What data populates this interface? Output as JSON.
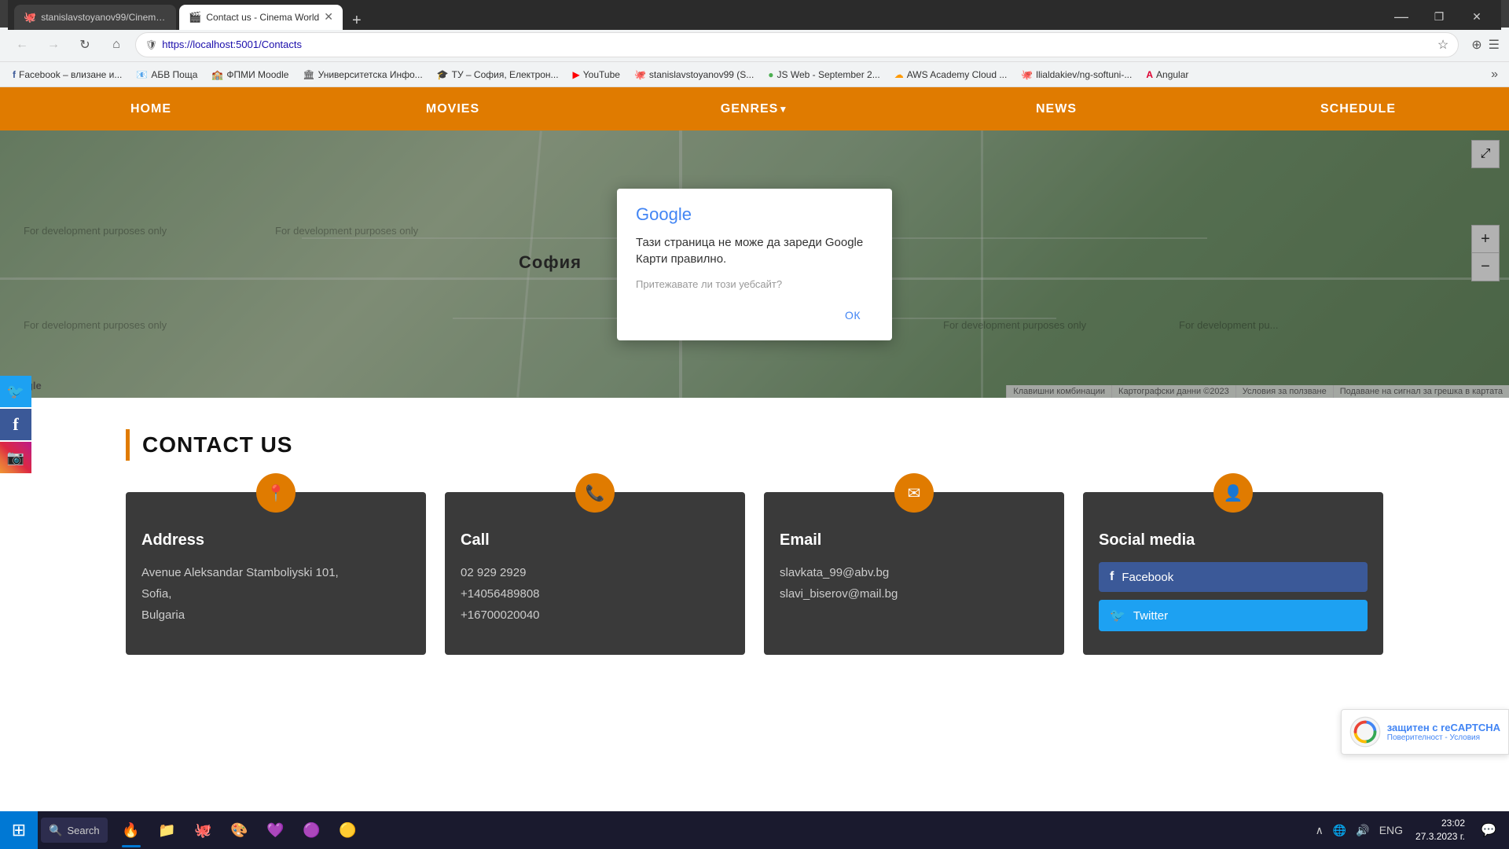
{
  "browser": {
    "tabs": [
      {
        "id": "tab1",
        "title": "stanislavstoyanov99/CinemaWo...",
        "active": false,
        "icon": "🐙"
      },
      {
        "id": "tab2",
        "title": "Contact us - Cinema World",
        "active": true,
        "icon": "🎬"
      }
    ],
    "url": "https://localhost:5001/Contacts",
    "new_tab_label": "+",
    "window_controls": [
      "—",
      "❐",
      "✕"
    ]
  },
  "bookmarks": [
    {
      "label": "Facebook – влизане и...",
      "icon": "f",
      "color": "#3b5998"
    },
    {
      "label": "АБВ Поща",
      "icon": "📧",
      "color": "#e53935"
    },
    {
      "label": "ФПМИ Moodle",
      "icon": "📚",
      "color": "#f57c00"
    },
    {
      "label": "Университетска Инфо...",
      "icon": "🏛",
      "color": "#1565c0"
    },
    {
      "label": "ТУ – София, Електрон...",
      "icon": "🎓",
      "color": "#1565c0"
    },
    {
      "label": "YouTube",
      "icon": "▶",
      "color": "#ff0000"
    },
    {
      "label": "stanislavstoyanov99 (S...",
      "icon": "🐙",
      "color": "#333"
    },
    {
      "label": "JS Web - September 2...",
      "icon": "🟢",
      "color": "#4caf50"
    },
    {
      "label": "AWS Academy Cloud ...",
      "icon": "☁",
      "color": "#ff9900"
    },
    {
      "label": "llialdakiev/ng-softuni-...",
      "icon": "🐙",
      "color": "#333"
    },
    {
      "label": "Angular",
      "icon": "A",
      "color": "#dd0031"
    }
  ],
  "nav": {
    "items": [
      {
        "label": "HOME",
        "has_arrow": false
      },
      {
        "label": "MOVIES",
        "has_arrow": false
      },
      {
        "label": "GENRES",
        "has_arrow": true
      },
      {
        "label": "NEWS",
        "has_arrow": false
      },
      {
        "label": "SCHEDULE",
        "has_arrow": false
      }
    ]
  },
  "map": {
    "city_label": "София",
    "dev_texts": [
      "For development purposes only",
      "For development purposes only",
      "For development purposes only",
      "For development purposes only",
      "For development purposes only",
      "For development purposes only"
    ],
    "watermark": "Google",
    "bottom_bar": [
      "Клавишни комбинации",
      "Картографски данни ©2023",
      "Условия за ползване",
      "Подаване на сигнал за грешка в картата"
    ]
  },
  "google_dialog": {
    "logo": "Google",
    "title": "Тази страница не може да зареди Google Карти правилно.",
    "subtitle": "Притежавате ли този уебсайт?",
    "ok_label": "ОК"
  },
  "contact": {
    "section_title": "CONTACT US",
    "cards": [
      {
        "id": "address",
        "icon": "📍",
        "title": "Address",
        "lines": [
          "Avenue Aleksandar Stamboliyski 101,",
          "Sofia,",
          "Bulgaria"
        ]
      },
      {
        "id": "call",
        "icon": "📞",
        "title": "Call",
        "lines": [
          "02 929 2929",
          "+14056489808",
          "+16700020040"
        ]
      },
      {
        "id": "email",
        "icon": "✉",
        "title": "Email",
        "lines": [
          "slavkata_99@abv.bg",
          "slavi_biserov@mail.bg"
        ]
      },
      {
        "id": "social",
        "icon": "👤",
        "title": "Social media",
        "social_buttons": [
          {
            "label": "Facebook",
            "class": "facebook",
            "icon": "f"
          },
          {
            "label": "Twitter",
            "class": "twitter",
            "icon": "🐦"
          }
        ]
      }
    ]
  },
  "floating_social": [
    {
      "icon": "🐦",
      "class": "twitter",
      "label": "Twitter"
    },
    {
      "icon": "f",
      "class": "facebook",
      "label": "Facebook"
    },
    {
      "icon": "📷",
      "class": "instagram",
      "label": "Instagram"
    }
  ],
  "recaptcha": {
    "protected_text": "защитен с reCAPTCHA",
    "links": "Поверителност - Условия"
  },
  "taskbar": {
    "clock_time": "23:02",
    "clock_date": "27.3.2023 г.",
    "lang": "ENG",
    "apps": [
      {
        "icon": "🪟",
        "label": "Start"
      },
      {
        "icon": "🔍",
        "label": "Search",
        "is_search": true
      },
      {
        "icon": "🔥",
        "label": "Firefox",
        "active": true
      },
      {
        "icon": "📁",
        "label": "File Explorer"
      },
      {
        "icon": "🐙",
        "label": "GitHub"
      },
      {
        "icon": "🎨",
        "label": "Paint"
      },
      {
        "icon": "💜",
        "label": "Visual Studio"
      },
      {
        "icon": "🟣",
        "label": "App"
      },
      {
        "icon": "🟡",
        "label": "App2"
      }
    ]
  }
}
